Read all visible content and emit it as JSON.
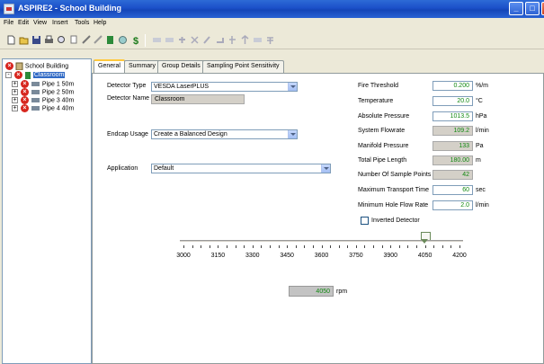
{
  "window": {
    "title": "ASPIRE2 - School Building",
    "controls": [
      "0",
      "1",
      "r"
    ]
  },
  "menu": [
    "File",
    "Edit",
    "View",
    "Insert",
    "Tools",
    "Help"
  ],
  "toolbar_icons": [
    "new-icon",
    "open-icon",
    "save-icon",
    "print-icon",
    "preview-icon",
    "copy-icon",
    "pipe-icon",
    "pipe-bend-icon",
    "detector-icon",
    "fan-icon",
    "cost-icon",
    "hole-icon",
    "cap-icon",
    "elbow-icon",
    "delete-icon",
    "tool-a-icon",
    "tool-b-icon",
    "tool-c-icon",
    "tool-d-icon",
    "tool-e-icon",
    "tool-f-icon"
  ],
  "tree": {
    "root": "School Building",
    "detector": "Classroom",
    "pipes": [
      "Pipe 1 50m",
      "Pipe 2 50m",
      "Pipe 3 40m",
      "Pipe 4 40m"
    ]
  },
  "tabs": [
    "General",
    "Summary",
    "Group Details",
    "Sampling Point Sensitivity"
  ],
  "general": {
    "detector_type_label": "Detector Type",
    "detector_type": "VESDA LaserPLUS",
    "detector_name_label": "Detector Name",
    "detector_name": "Classroom",
    "endcap_label": "Endcap Usage",
    "endcap": "Create a Balanced Design",
    "application_label": "Application",
    "application": "Default"
  },
  "params": [
    {
      "label": "Fire Threshold",
      "value": "0.200",
      "unit": "%/m",
      "editable": true
    },
    {
      "label": "Temperature",
      "value": "20.0",
      "unit": "°C",
      "editable": true
    },
    {
      "label": "Absolute Pressure",
      "value": "1013.5",
      "unit": "hPa",
      "editable": true
    },
    {
      "label": "System Flowrate",
      "value": "109.2",
      "unit": "l/min",
      "editable": false
    },
    {
      "label": "Manifold Pressure",
      "value": "133",
      "unit": "Pa",
      "editable": false
    },
    {
      "label": "Total Pipe Length",
      "value": "180.00",
      "unit": "m",
      "editable": false
    },
    {
      "label": "Number Of Sample Points",
      "value": "42",
      "unit": "",
      "editable": false
    },
    {
      "label": "Maximum Transport Time",
      "value": "60",
      "unit": "sec",
      "editable": true
    },
    {
      "label": "Minimum Hole Flow Rate",
      "value": "2.0",
      "unit": "l/min",
      "editable": true
    }
  ],
  "inverted_detector_label": "Inverted Detector",
  "inverted_detector_checked": false,
  "slider": {
    "min": 3000,
    "max": 4200,
    "value": 4050,
    "labels": [
      "3000",
      "3150",
      "3300",
      "3450",
      "3600",
      "3750",
      "3900",
      "4050",
      "4200"
    ]
  },
  "rpm": {
    "value": "4050",
    "unit": "rpm"
  }
}
